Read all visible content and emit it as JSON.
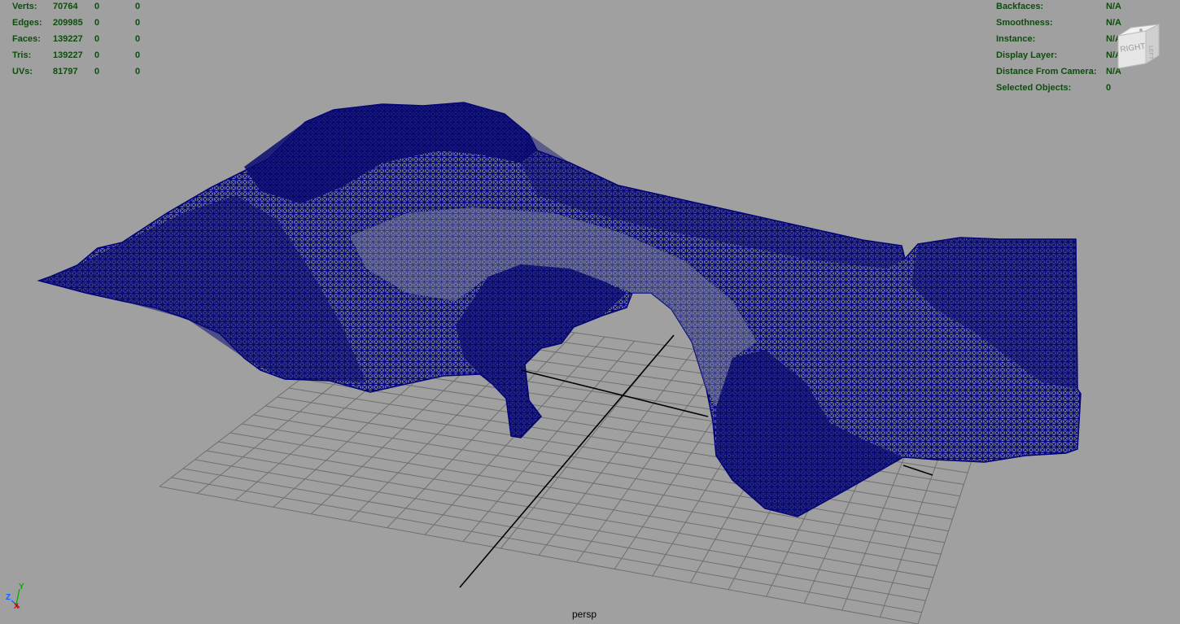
{
  "viewport": {
    "camera_name": "persp"
  },
  "hud_left": {
    "rows": [
      {
        "label": "Verts:",
        "values": [
          "70764",
          "0",
          "0"
        ]
      },
      {
        "label": "Edges:",
        "values": [
          "209985",
          "0",
          "0"
        ]
      },
      {
        "label": "Faces:",
        "values": [
          "139227",
          "0",
          "0"
        ]
      },
      {
        "label": "Tris:",
        "values": [
          "139227",
          "0",
          "0"
        ]
      },
      {
        "label": "UVs:",
        "values": [
          "81797",
          "0",
          "0"
        ]
      }
    ]
  },
  "hud_right": {
    "rows": [
      {
        "label": "Backfaces:",
        "value": "N/A"
      },
      {
        "label": "Smoothness:",
        "value": "N/A"
      },
      {
        "label": "Instance:",
        "value": "N/A"
      },
      {
        "label": "Display Layer:",
        "value": "N/A"
      },
      {
        "label": "Distance From Camera:",
        "value": "N/A"
      },
      {
        "label": "Selected Objects:",
        "value": "0"
      }
    ]
  },
  "view_cube": {
    "face_label": "RIGHT",
    "side_label": "LEFT"
  },
  "axis_gizmo": {
    "y_label": "Y",
    "z_label": "Z",
    "x_label": "X"
  },
  "colors": {
    "background": "#a0a0a0",
    "hud_text": "#0e4d0e",
    "wireframe": "#00007a",
    "grid_line": "#6f6f6f",
    "grid_axis": "#000000",
    "axis_x": "#d40000",
    "axis_y": "#00b000",
    "axis_z": "#1060ff"
  }
}
